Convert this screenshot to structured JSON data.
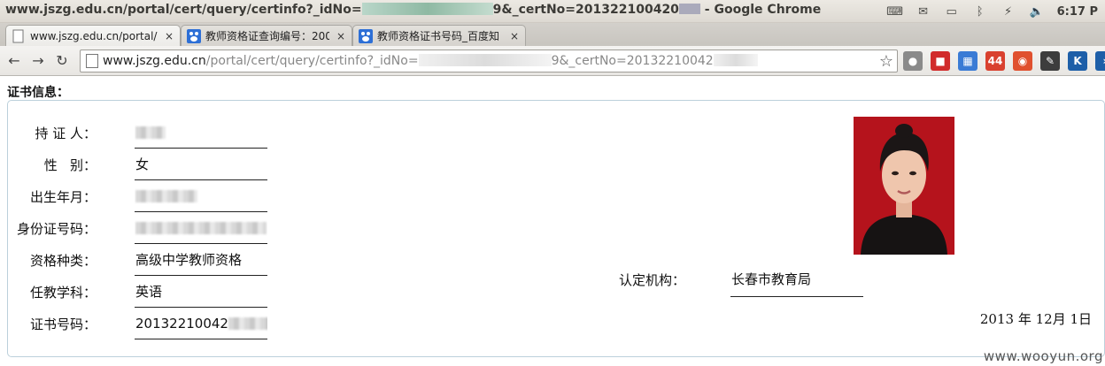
{
  "window": {
    "title_prefix": "www.jszg.edu.cn/portal/cert/query/certinfo?_idNo=",
    "title_mid": "9&_certNo=201322100420",
    "title_suffix": " - Google Chrome",
    "clock": "6:17 P"
  },
  "tray_icons": [
    "keyboard-icon",
    "mail-icon",
    "battery-icon",
    "bluetooth-icon",
    "network-icon",
    "volume-icon"
  ],
  "tabs": [
    {
      "label": "www.jszg.edu.cn/portal/c",
      "close": "×",
      "active": true
    },
    {
      "label": "教师资格证查询编号：200",
      "close": "×",
      "active": false
    },
    {
      "label": "教师资格证书号码_百度知",
      "close": "×",
      "active": false
    }
  ],
  "toolbar": {
    "back": "←",
    "forward": "→",
    "reload": "↻",
    "url_host": "www.jszg.edu.cn",
    "url_path": "/portal/cert/query/certinfo?_idNo=",
    "url_mid": "9&_certNo=20132210042",
    "star": "☆"
  },
  "extensions": [
    {
      "name": "globe-ext",
      "glyph": "●",
      "color": "#8a8a8a"
    },
    {
      "name": "stop-ext",
      "glyph": "■",
      "color": "#d12b2b"
    },
    {
      "name": "calendar-ext",
      "glyph": "▦",
      "color": "#3a7bd5"
    },
    {
      "name": "gmail-ext",
      "glyph": "44",
      "color": "#d9412f"
    },
    {
      "name": "weibo-ext",
      "glyph": "◉",
      "color": "#e0502e"
    },
    {
      "name": "evernote-ext",
      "glyph": "✎",
      "color": "#3d3d3d"
    },
    {
      "name": "k-ext",
      "glyph": "K",
      "color": "#1e5fa8"
    },
    {
      "name": "overflow-ext",
      "glyph": "›",
      "color": "#1e5fa8"
    }
  ],
  "page": {
    "section_title": "证书信息：",
    "fields": [
      {
        "label": "持 证 人：",
        "value": ""
      },
      {
        "label": " 性   别：",
        "value": "女"
      },
      {
        "label": "出生年月：",
        "value": ""
      },
      {
        "label": "身份证号码：",
        "value": ""
      },
      {
        "label": "资格种类：",
        "value": "高级中学教师资格"
      },
      {
        "label": "任教学科：",
        "value": "英语"
      },
      {
        "label": "证书号码：",
        "value": "20132210042"
      }
    ],
    "authority_label": "认定机构：",
    "authority_value": "长春市教育局",
    "date": "2013 年 12月 1日"
  },
  "watermark": "www.wooyun.org"
}
